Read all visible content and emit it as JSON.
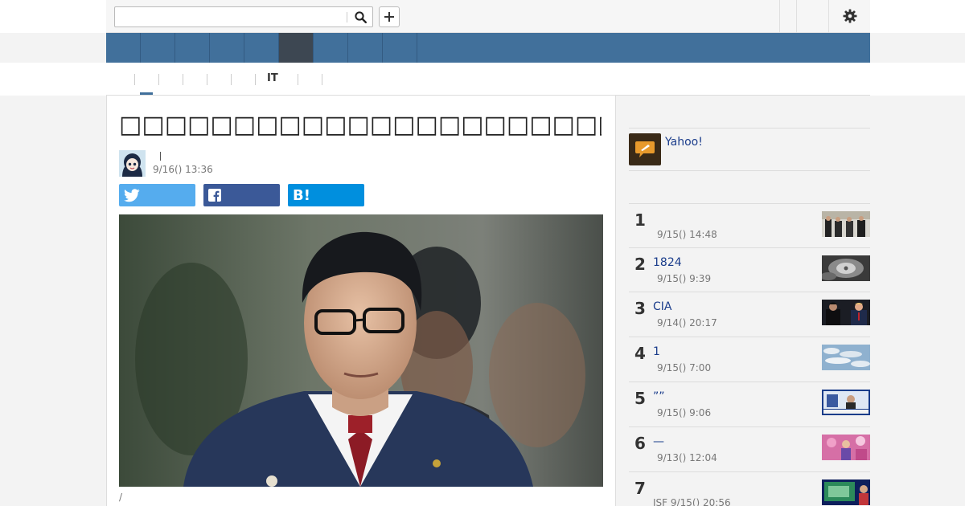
{
  "search": {
    "value": "",
    "placeholder": ""
  },
  "nav": {
    "tab_count": 9,
    "active_index": 5
  },
  "subnav": {
    "items": [
      "IT"
    ]
  },
  "article": {
    "title": "□□□□□□□□□□□□□□□□□□□□□□□□□□□□□",
    "author_separator": "|",
    "date": "9/16() 13:36",
    "share": {
      "hatena_label": "B!"
    },
    "photo_caption": "/"
  },
  "sidebar": {
    "yahoo_label": "Yahoo!",
    "ranking": [
      {
        "rank": "1",
        "title": "",
        "date": "9/15() 14:48",
        "date_prefix": ""
      },
      {
        "rank": "2",
        "title": "1824",
        "date": "9/15() 9:39",
        "date_prefix": ""
      },
      {
        "rank": "3",
        "title": "CIA",
        "date": "9/14() 20:17",
        "date_prefix": ""
      },
      {
        "rank": "4",
        "title": "1",
        "date": "9/15() 7:00",
        "date_prefix": ""
      },
      {
        "rank": "5",
        "title": "””",
        "date": "9/15() 9:06",
        "date_prefix": ""
      },
      {
        "rank": "6",
        "title": "—",
        "date": "9/13() 12:04",
        "date_prefix": ""
      },
      {
        "rank": "7",
        "title": "",
        "date": "9/15() 20:56",
        "date_prefix": "JSF"
      }
    ]
  },
  "colors": {
    "nav_blue": "#41709b",
    "nav_active": "#3d4752",
    "twitter": "#55acee",
    "facebook": "#3b5998",
    "hatena": "#008fde",
    "link": "#1a3c8b"
  },
  "icons": [
    "search-icon",
    "plus-icon",
    "gear-icon",
    "twitter-icon",
    "facebook-icon",
    "hatena-bookmark-icon",
    "yahoo-news-icon"
  ]
}
